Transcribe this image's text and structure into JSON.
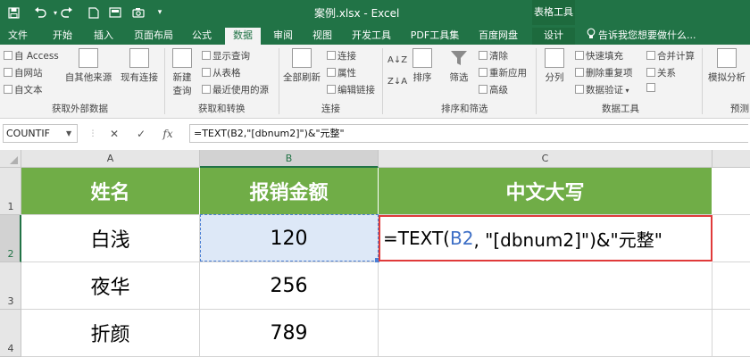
{
  "titlebar": {
    "title": "案例.xlsx - Excel",
    "context_title": "表格工具",
    "quick_access": [
      "save-icon",
      "undo-icon",
      "redo-icon",
      "new-icon",
      "open-icon",
      "camera-icon",
      "customize-icon"
    ]
  },
  "tabs": {
    "items": [
      "文件",
      "开始",
      "插入",
      "页面布局",
      "公式",
      "数据",
      "审阅",
      "视图",
      "开发工具",
      "PDF工具集",
      "百度网盘",
      "设计"
    ],
    "active": "数据",
    "tell_me": "告诉我您想要做什么..."
  },
  "ribbon": {
    "get_external": {
      "access": "自 Access",
      "web": "自网站",
      "text": "自文本",
      "other": "自其他来源",
      "existing": "现有连接",
      "label": "获取外部数据"
    },
    "get_transform": {
      "new_query": "新建",
      "new_query_2": "查询",
      "show_queries": "显示查询",
      "from_table": "从表格",
      "recent_sources": "最近使用的源",
      "label": "获取和转换"
    },
    "connections": {
      "refresh_all": "全部刷新",
      "connections": "连接",
      "properties": "属性",
      "edit_links": "编辑链接",
      "label": "连接"
    },
    "sort_filter": {
      "sort": "排序",
      "filter": "筛选",
      "clear": "清除",
      "reapply": "重新应用",
      "advanced": "高级",
      "label": "排序和筛选"
    },
    "data_tools": {
      "text_to_columns": "分列",
      "flash_fill": "快速填充",
      "remove_duplicates": "删除重复项",
      "data_validation": "数据验证",
      "consolidate": "合并计算",
      "relationships": "关系",
      "label": "数据工具"
    },
    "forecast": {
      "what_if": "模拟分析",
      "label": "预测"
    }
  },
  "formula_bar": {
    "name_box": "COUNTIF",
    "cancel": "✕",
    "enter": "✓",
    "fx": "fx",
    "formula": "=TEXT(B2,\"[dbnum2]\")&\"元整\""
  },
  "grid": {
    "columns": [
      "A",
      "B",
      "C"
    ],
    "rows": [
      "1",
      "2",
      "3",
      "4"
    ],
    "header_row": [
      "姓名",
      "报销金额",
      "中文大写"
    ],
    "data": [
      [
        "白浅",
        "120"
      ],
      [
        "夜华",
        "256"
      ],
      [
        "折颜",
        "789"
      ]
    ],
    "edit_cell": {
      "prefix": "=TEXT(",
      "ref": "B2",
      "suffix": ", \"[dbnum2]\")&\"元整\""
    }
  },
  "colors": {
    "excel_green": "#217346",
    "header_fill": "#70ad47",
    "edit_border": "#e03a3a",
    "ref_blue": "#3e6fc6"
  }
}
